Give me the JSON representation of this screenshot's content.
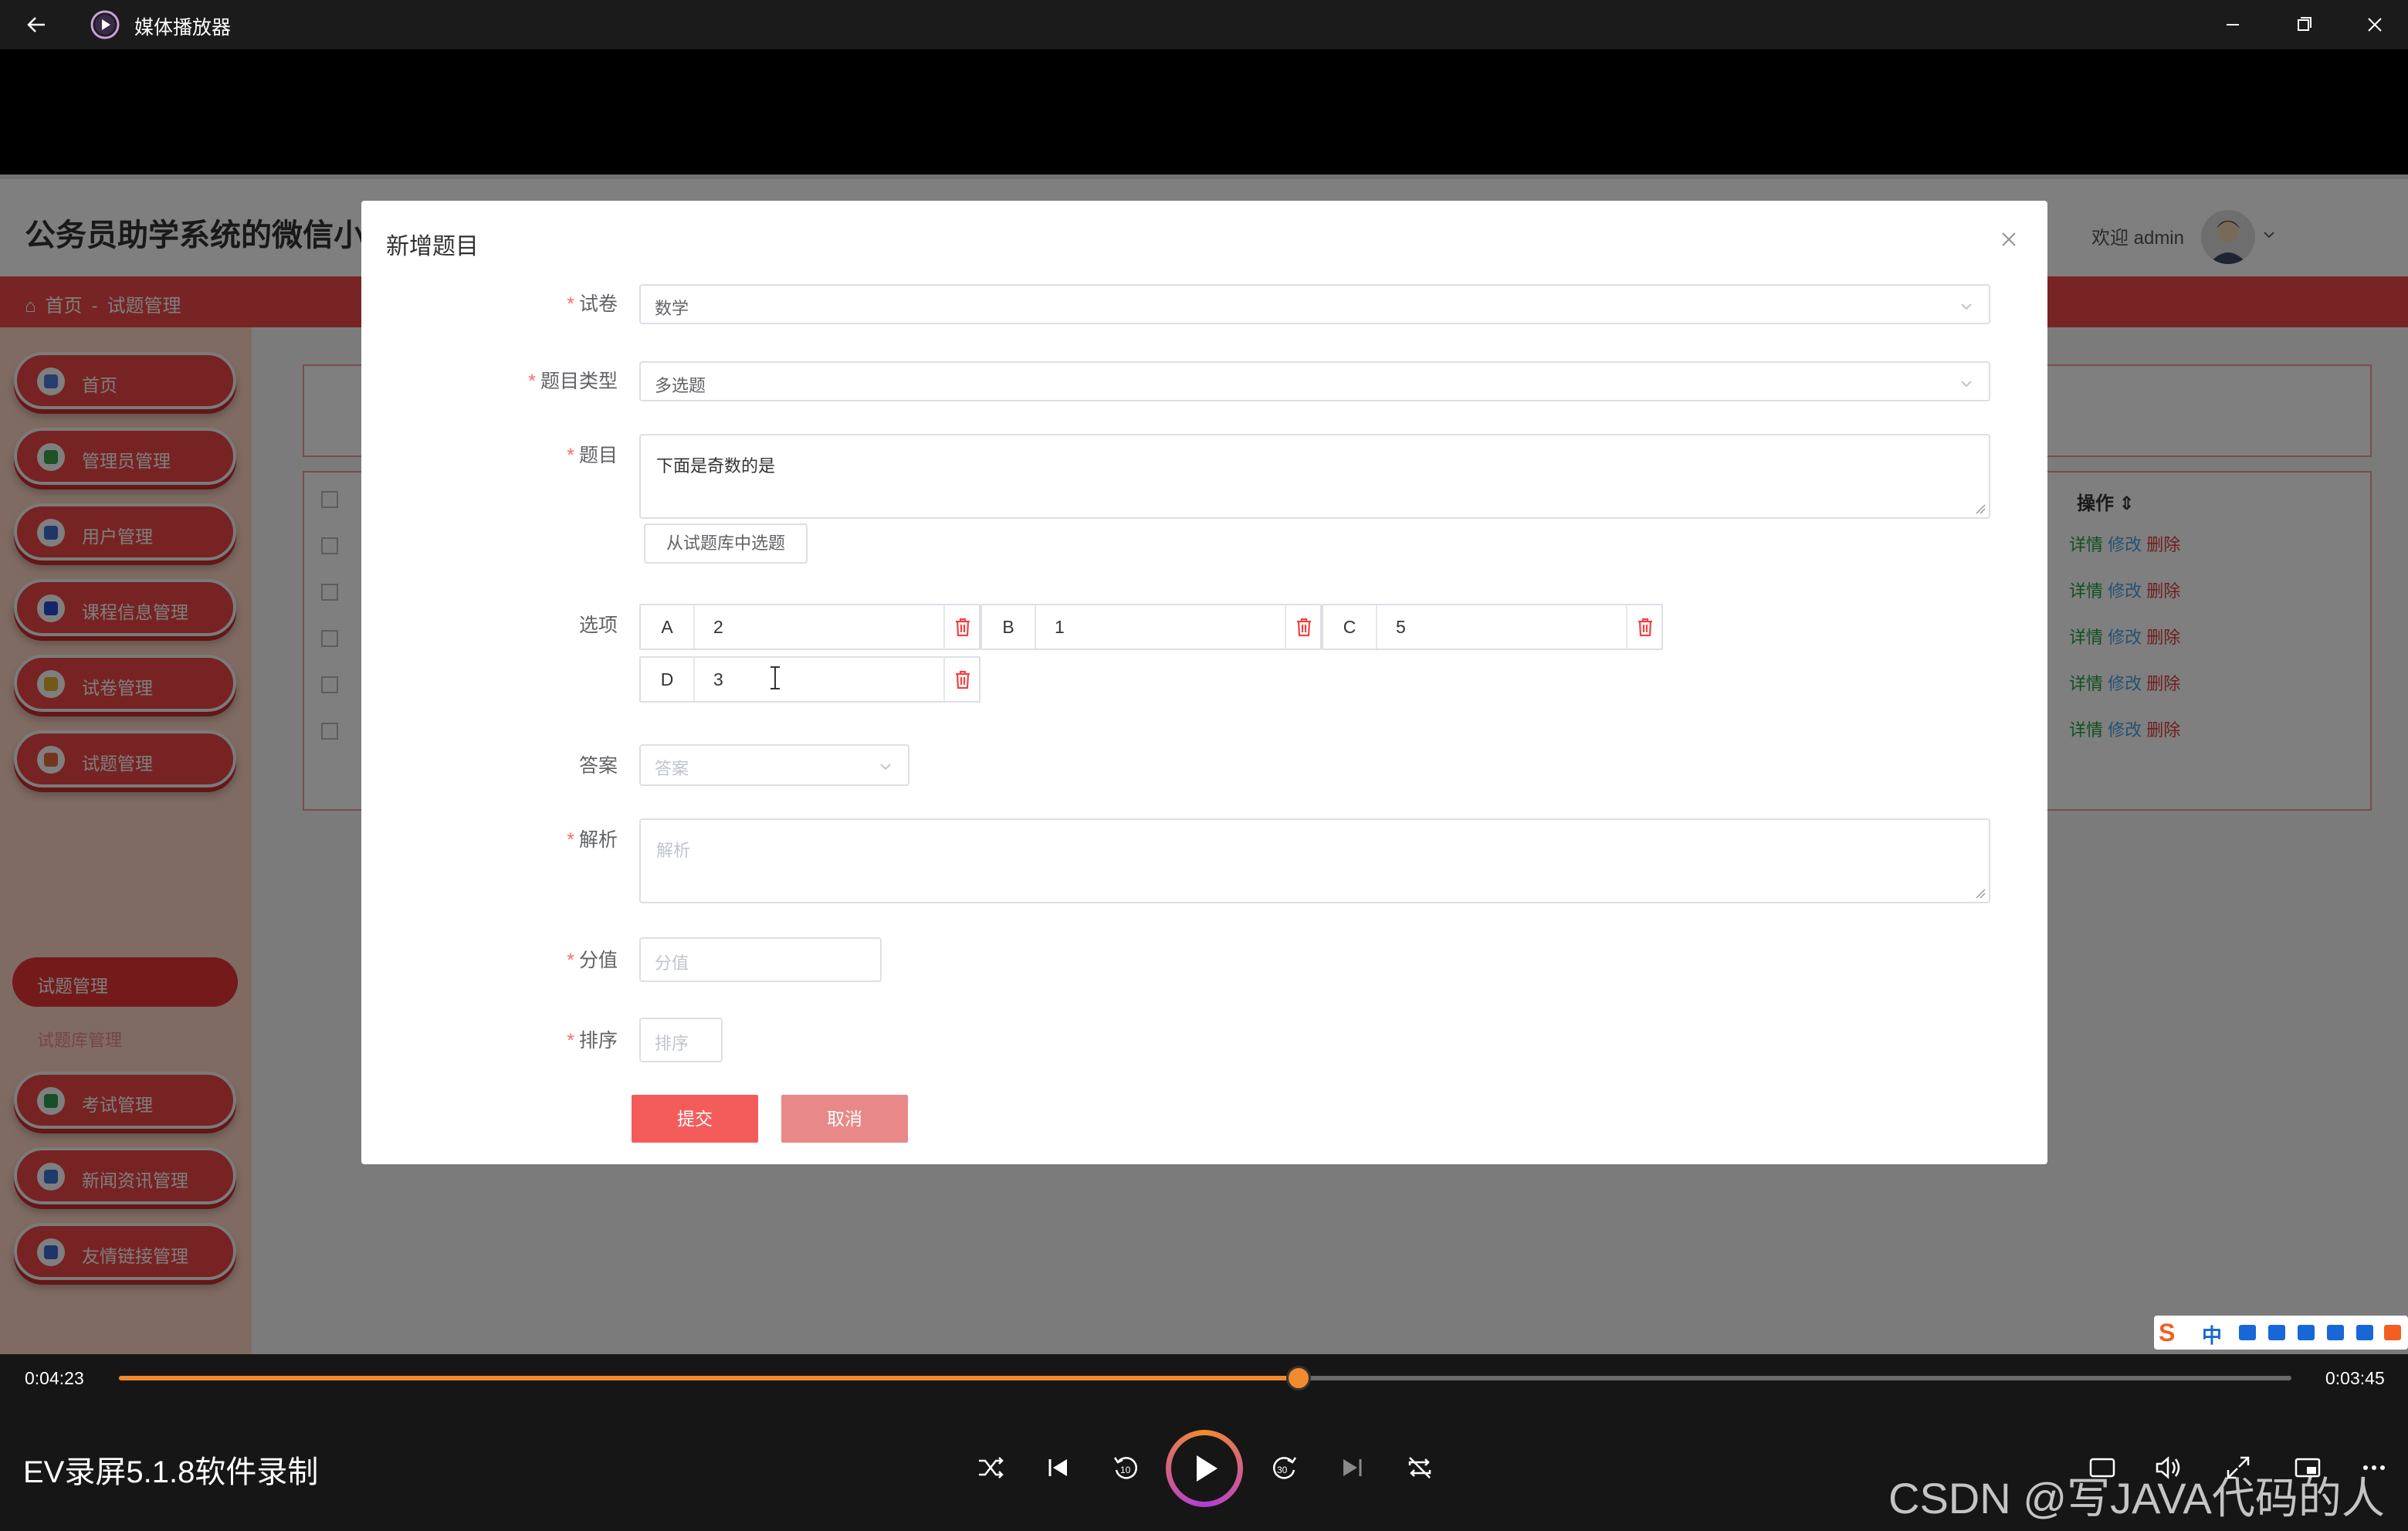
{
  "window": {
    "title": "媒体播放器"
  },
  "app": {
    "title": "公务员助学系统的微信小",
    "welcome": "欢迎 admin",
    "breadcrumb": [
      "首页",
      "-",
      "试题管理"
    ]
  },
  "sidebar": {
    "items": [
      {
        "label": "首页",
        "color": "#4e7bd6"
      },
      {
        "label": "管理员管理",
        "color": "#3ca34a"
      },
      {
        "label": "用户管理",
        "color": "#3d6fd1"
      },
      {
        "label": "课程信息管理",
        "color": "#2b4ad9"
      },
      {
        "label": "试卷管理",
        "color": "#e2b22c"
      },
      {
        "label": "试题管理",
        "color": "#e86a3e"
      },
      {
        "label": "考试管理",
        "color": "#2f9e4f"
      },
      {
        "label": "新闻资讯管理",
        "color": "#3f77d6"
      },
      {
        "label": "友情链接管理",
        "color": "#3a6ad0"
      }
    ],
    "sub_active": "试题管理",
    "sub_item": "试题库管理"
  },
  "table": {
    "op_header": "操作",
    "row_actions": {
      "detail": "详情",
      "edit": "修改",
      "delete": "删除"
    },
    "row_count": 5
  },
  "modal": {
    "title": "新增题目",
    "fields": {
      "paper": {
        "label": "试卷",
        "value": "数学"
      },
      "type": {
        "label": "题目类型",
        "value": "多选题"
      },
      "question": {
        "label": "题目",
        "value": "下面是奇数的是"
      },
      "pick_button": "从试题库中选题",
      "options_label": "选项",
      "options": [
        {
          "letter": "A",
          "value": "2"
        },
        {
          "letter": "B",
          "value": "1"
        },
        {
          "letter": "C",
          "value": "5"
        },
        {
          "letter": "D",
          "value": "3"
        }
      ],
      "answer": {
        "label": "答案",
        "placeholder": "答案"
      },
      "analysis": {
        "label": "解析",
        "placeholder": "解析"
      },
      "score": {
        "label": "分值",
        "placeholder": "分值"
      },
      "order": {
        "label": "排序",
        "placeholder": "排序"
      }
    },
    "submit": "提交",
    "cancel": "取消"
  },
  "player": {
    "elapsed": "0:04:23",
    "remaining": "0:03:45",
    "progress": 0.543,
    "video_title": "EV录屏5.1.8软件录制",
    "watermark": "CSDN @写JAVA代码的人",
    "accent": "#f28a2e"
  },
  "ime": {
    "lang": "中"
  }
}
